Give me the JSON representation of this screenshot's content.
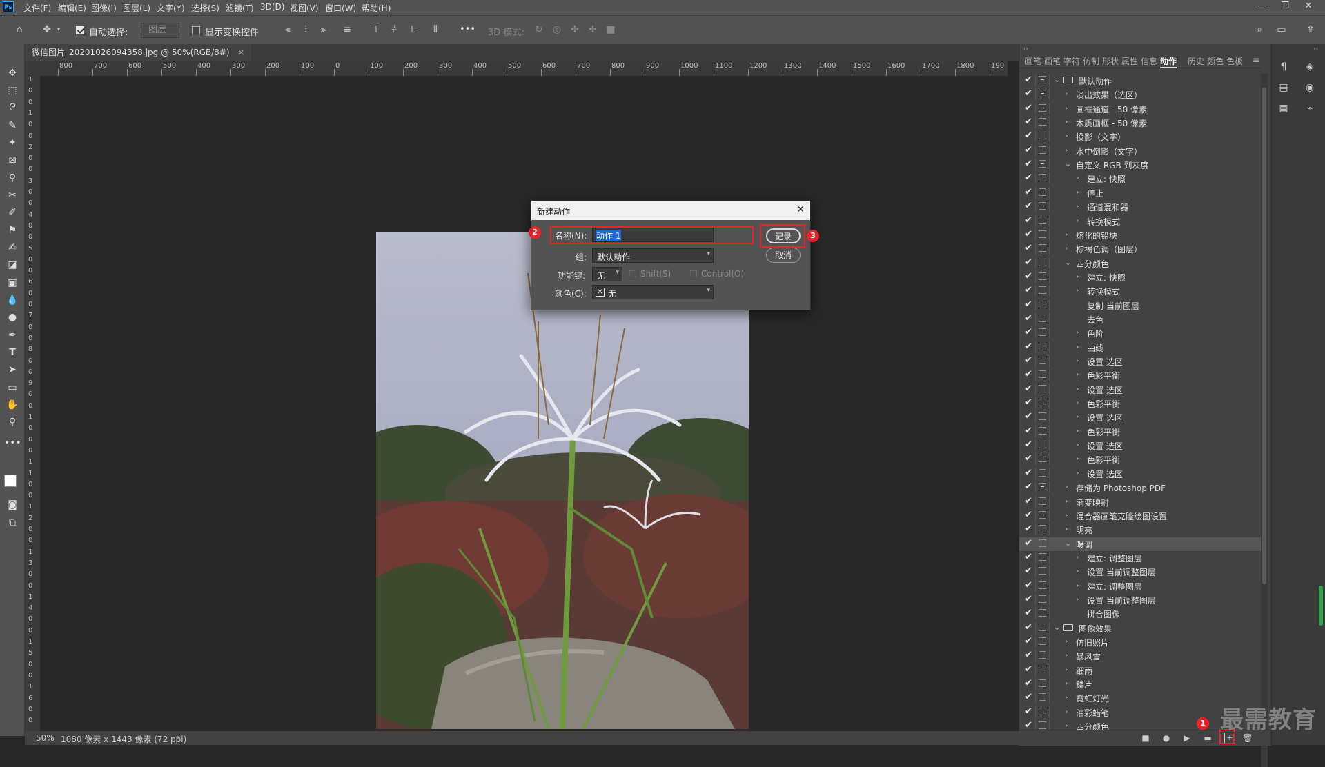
{
  "app": {
    "logo": "Ps"
  },
  "menu": [
    "文件(F)",
    "编辑(E)",
    "图像(I)",
    "图层(L)",
    "文字(Y)",
    "选择(S)",
    "滤镜(T)",
    "3D(D)",
    "视图(V)",
    "窗口(W)",
    "帮助(H)"
  ],
  "window_controls": {
    "minimize": "—",
    "restore": "❐",
    "close": "✕"
  },
  "options": {
    "auto_select_label": "自动选择:",
    "auto_select_checked": true,
    "layer_dropdown": "图层",
    "show_transform_label": "显示变换控件",
    "show_transform_checked": false,
    "more": "•••",
    "mode_3d_label": "3D 模式:"
  },
  "document": {
    "tab_title": "微信图片_20201026094358.jpg @ 50%(RGB/8#)",
    "tab_close": "×",
    "zoom": "50%",
    "status_info": "1080 像素 x 1443 像素 (72 ppi)"
  },
  "ruler": {
    "top_ticks": [
      "800",
      "700",
      "600",
      "500",
      "400",
      "300",
      "200",
      "100",
      "0",
      "100",
      "200",
      "300",
      "400",
      "500",
      "600",
      "700",
      "800",
      "900",
      "1000",
      "1100",
      "1200",
      "1300",
      "1400",
      "1500",
      "1600",
      "1700",
      "1800",
      "190"
    ],
    "left_ticks": [
      "1",
      "0",
      "0",
      "1",
      "0",
      "0",
      "2",
      "0",
      "0",
      "3",
      "0",
      "0",
      "4",
      "0",
      "0",
      "5",
      "0",
      "0",
      "6",
      "0",
      "0",
      "7",
      "0",
      "0",
      "8",
      "0",
      "0",
      "9",
      "0",
      "0",
      "1",
      "0",
      "0",
      "0",
      "1",
      "1",
      "0",
      "0",
      "1",
      "2",
      "0",
      "0",
      "1",
      "3",
      "0",
      "0",
      "1",
      "4",
      "0",
      "0",
      "1",
      "5",
      "0",
      "0",
      "1",
      "6",
      "0",
      "0"
    ]
  },
  "panel_tabs": [
    "画笔",
    "画笔",
    "字符",
    "仿制",
    "形状",
    "属性",
    "信息",
    "动作",
    "历史",
    "颜色",
    "色板"
  ],
  "panel_active_tab": "动作",
  "actions": [
    {
      "label": "默认动作",
      "level": 0,
      "type": "set",
      "expanded": true,
      "dialog": true
    },
    {
      "label": "淡出效果（选区）",
      "level": 1,
      "dialog": true
    },
    {
      "label": "画框通道 - 50 像素",
      "level": 1,
      "dialog": true
    },
    {
      "label": "木质画框 - 50 像素",
      "level": 1,
      "dialog": false
    },
    {
      "label": "投影（文字）",
      "level": 1,
      "dialog": false
    },
    {
      "label": "水中倒影（文字）",
      "level": 1,
      "dialog": false
    },
    {
      "label": "自定义 RGB 到灰度",
      "level": 1,
      "expanded": true,
      "dialog": true
    },
    {
      "label": "建立: 快照",
      "level": 2,
      "dialog": false
    },
    {
      "label": "停止",
      "level": 2,
      "dialog": true
    },
    {
      "label": "通道混和器",
      "level": 2,
      "dialog": true
    },
    {
      "label": "转换模式",
      "level": 2,
      "dialog": false
    },
    {
      "label": "熔化的铅块",
      "level": 1,
      "dialog": false
    },
    {
      "label": "棕褐色调（图层）",
      "level": 1,
      "dialog": false
    },
    {
      "label": "四分颜色",
      "level": 1,
      "expanded": true,
      "dialog": false
    },
    {
      "label": "建立: 快照",
      "level": 2,
      "dialog": false
    },
    {
      "label": "转换模式",
      "level": 2,
      "dialog": false
    },
    {
      "label": "复制 当前图层",
      "level": 2,
      "nochev": true,
      "dialog": false
    },
    {
      "label": "去色",
      "level": 2,
      "nochev": true,
      "dialog": false
    },
    {
      "label": "色阶",
      "level": 2,
      "dialog": false
    },
    {
      "label": "曲线",
      "level": 2,
      "dialog": false
    },
    {
      "label": "设置 选区",
      "level": 2,
      "dialog": false
    },
    {
      "label": "色彩平衡",
      "level": 2,
      "dialog": false
    },
    {
      "label": "设置 选区",
      "level": 2,
      "dialog": false
    },
    {
      "label": "色彩平衡",
      "level": 2,
      "dialog": false
    },
    {
      "label": "设置 选区",
      "level": 2,
      "dialog": false
    },
    {
      "label": "色彩平衡",
      "level": 2,
      "dialog": false
    },
    {
      "label": "设置 选区",
      "level": 2,
      "dialog": false
    },
    {
      "label": "色彩平衡",
      "level": 2,
      "dialog": false
    },
    {
      "label": "设置 选区",
      "level": 2,
      "dialog": false
    },
    {
      "label": "存储为 Photoshop PDF",
      "level": 1,
      "dialog": true
    },
    {
      "label": "渐变映射",
      "level": 1,
      "dialog": false
    },
    {
      "label": "混合器画笔克隆绘图设置",
      "level": 1,
      "dialog": true
    },
    {
      "label": "明亮",
      "level": 1,
      "dialog": false
    },
    {
      "label": "暖调",
      "level": 1,
      "expanded": true,
      "selected": true,
      "dialog": false
    },
    {
      "label": "建立: 调整图层",
      "level": 2,
      "dialog": false
    },
    {
      "label": "设置 当前调整图层",
      "level": 2,
      "dialog": false
    },
    {
      "label": "建立: 调整图层",
      "level": 2,
      "dialog": false
    },
    {
      "label": "设置 当前调整图层",
      "level": 2,
      "dialog": false
    },
    {
      "label": "拼合图像",
      "level": 2,
      "nochev": true,
      "dialog": false
    },
    {
      "label": "图像效果",
      "level": 0,
      "type": "set",
      "expanded": true,
      "dialog": false
    },
    {
      "label": "仿旧照片",
      "level": 1,
      "dialog": false
    },
    {
      "label": "暴风雪",
      "level": 1,
      "dialog": false
    },
    {
      "label": "细雨",
      "level": 1,
      "dialog": false
    },
    {
      "label": "鳞片",
      "level": 1,
      "dialog": false
    },
    {
      "label": "霓虹灯光",
      "level": 1,
      "dialog": false
    },
    {
      "label": "油彩蜡笔",
      "level": 1,
      "dialog": false
    },
    {
      "label": "四分颜色",
      "level": 1,
      "dialog": false
    }
  ],
  "dialog": {
    "title": "新建动作",
    "close": "✕",
    "name_label": "名称(N):",
    "name_value": "动作 1",
    "group_label": "组:",
    "group_value": "默认动作",
    "fkey_label": "功能键:",
    "fkey_value": "无",
    "shift_label": "Shift(S)",
    "control_label": "Control(O)",
    "color_label": "颜色(C):",
    "color_value": "无",
    "record_button": "记录",
    "cancel_button": "取消"
  },
  "callouts": [
    "1",
    "2",
    "3"
  ],
  "watermark": "最需教育",
  "colors": {
    "callout_red": "#e8242b",
    "accent_blue": "#1473e6"
  }
}
